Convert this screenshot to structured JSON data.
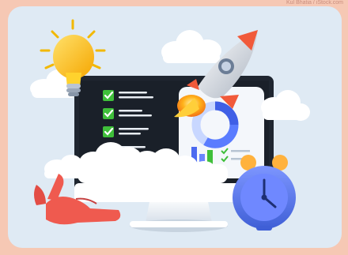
{
  "credit": "Kul Bhatia / iStock.com",
  "colors": {
    "page_background": "#f6c8b4",
    "card_background": "#dfeaf4",
    "monitor_bezel": "#1f2630",
    "checkbox_green": "#3fbf3a",
    "rocket_orange": "#f15a3a",
    "clock_blue": "#4d6ee6",
    "bulb_yellow": "#ffc21a"
  },
  "checklist_items": 4,
  "chart_bars": 3
}
